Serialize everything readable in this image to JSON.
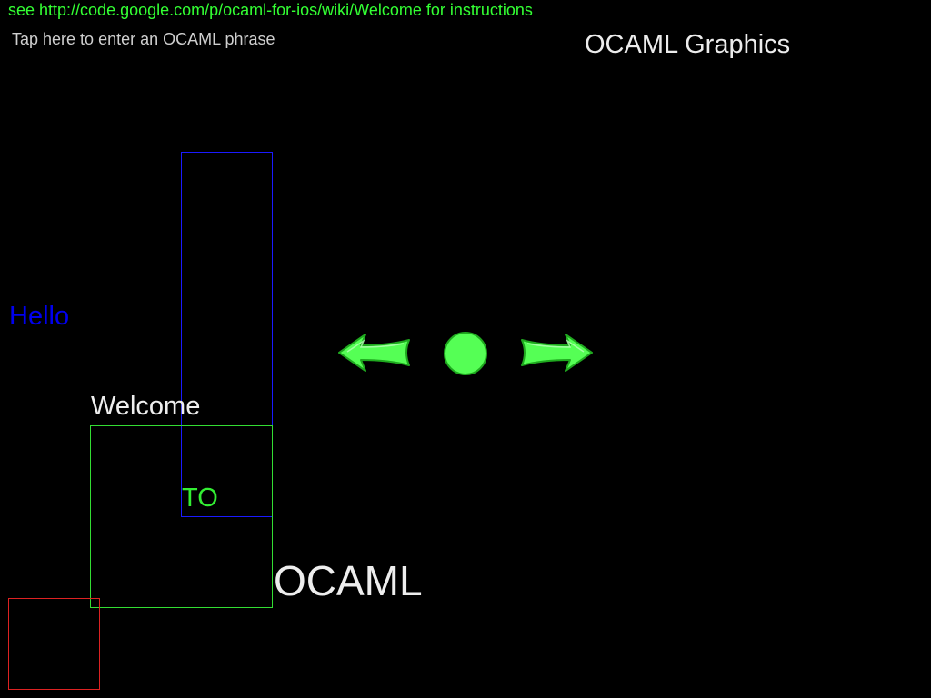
{
  "header": {
    "instructions_text": "see http://code.google.com/p/ocaml-for-ios/wiki/Welcome for instructions",
    "phrase_prompt": "Tap here to enter an OCAML phrase",
    "title": "OCAML Graphics"
  },
  "canvas": {
    "words": [
      {
        "text": "Hello",
        "color": "#0000ee"
      },
      {
        "text": "Welcome",
        "color": "#eeeeee"
      },
      {
        "text": "TO",
        "color": "#33ee33"
      },
      {
        "text": "OCAML",
        "color": "#eeeeee"
      }
    ],
    "rectangles": [
      {
        "color": "#1a1aff"
      },
      {
        "color": "#33dd33"
      },
      {
        "color": "#dd2222"
      }
    ]
  },
  "navigation": {
    "prev_icon": "left-arrow-icon",
    "center_icon": "circle-icon",
    "next_icon": "right-arrow-icon",
    "accent_color": "#55ff55"
  },
  "colors": {
    "background": "#000000",
    "link": "#33ff33",
    "prompt": "#cfcfcf",
    "title": "#ececec"
  }
}
